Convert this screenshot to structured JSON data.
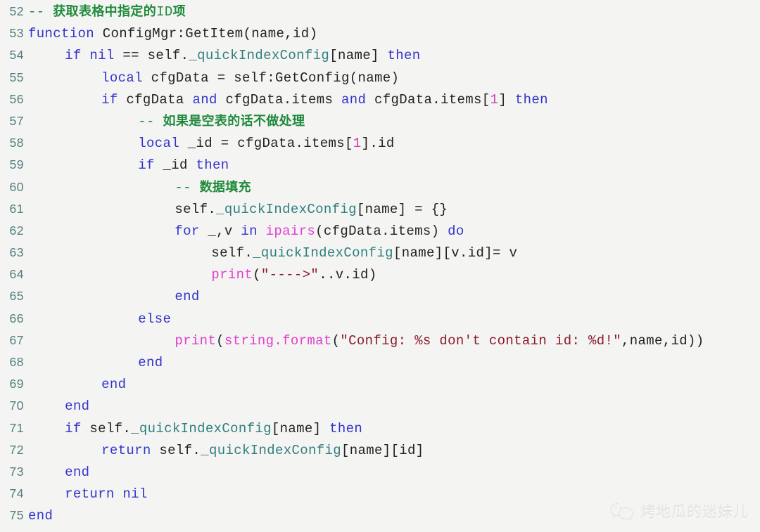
{
  "editor": {
    "language": "Lua",
    "background_color": "#f4f4f2",
    "line_number_color": "#4f7f7f",
    "first_line": 52,
    "last_line": 75
  },
  "colors": {
    "keyword": "#3333cc",
    "comment": "#1f8a3c",
    "builtin_function": "#e23fd0",
    "string": "#8b1a2b",
    "number": "#d13fb8",
    "property": "#2f7f7f",
    "plain": "#222222",
    "line_number": "#4f7f7f",
    "background": "#f4f4f2",
    "watermark": "#e6e6e4"
  },
  "lines": [
    {
      "num": "52",
      "indent": 0,
      "tokens": [
        {
          "t": "-- ",
          "c": "t-com"
        },
        {
          "t": "获取表格中指定的",
          "c": "t-com-cjk"
        },
        {
          "t": "ID",
          "c": "t-com"
        },
        {
          "t": "项",
          "c": "t-com-cjk"
        }
      ]
    },
    {
      "num": "53",
      "indent": 0,
      "tokens": [
        {
          "t": "function",
          "c": "t-kw"
        },
        {
          "t": " ConfigMgr:GetItem(name,id)",
          "c": "t-plain"
        }
      ]
    },
    {
      "num": "54",
      "indent": 4,
      "tokens": [
        {
          "t": "if",
          "c": "t-kw"
        },
        {
          "t": " ",
          "c": "t-plain"
        },
        {
          "t": "nil",
          "c": "t-kw"
        },
        {
          "t": " == self.",
          "c": "t-plain"
        },
        {
          "t": "_quickIndexConfig",
          "c": "t-prop"
        },
        {
          "t": "[name] ",
          "c": "t-plain"
        },
        {
          "t": "then",
          "c": "t-kw"
        }
      ]
    },
    {
      "num": "55",
      "indent": 8,
      "tokens": [
        {
          "t": "local",
          "c": "t-kw"
        },
        {
          "t": " cfgData = self:GetConfig(name)",
          "c": "t-plain"
        }
      ]
    },
    {
      "num": "56",
      "indent": 8,
      "tokens": [
        {
          "t": "if",
          "c": "t-kw"
        },
        {
          "t": " cfgData ",
          "c": "t-plain"
        },
        {
          "t": "and",
          "c": "t-kw"
        },
        {
          "t": " cfgData.items ",
          "c": "t-plain"
        },
        {
          "t": "and",
          "c": "t-kw"
        },
        {
          "t": " cfgData.items[",
          "c": "t-plain"
        },
        {
          "t": "1",
          "c": "t-num"
        },
        {
          "t": "] ",
          "c": "t-plain"
        },
        {
          "t": "then",
          "c": "t-kw"
        }
      ]
    },
    {
      "num": "57",
      "indent": 12,
      "tokens": [
        {
          "t": "-- ",
          "c": "t-com"
        },
        {
          "t": "如果是空表的话不做处理",
          "c": "t-com-cjk"
        }
      ]
    },
    {
      "num": "58",
      "indent": 12,
      "tokens": [
        {
          "t": "local",
          "c": "t-kw"
        },
        {
          "t": " _id = cfgData.items[",
          "c": "t-plain"
        },
        {
          "t": "1",
          "c": "t-num"
        },
        {
          "t": "].id",
          "c": "t-plain"
        }
      ]
    },
    {
      "num": "59",
      "indent": 12,
      "tokens": [
        {
          "t": "if",
          "c": "t-kw"
        },
        {
          "t": " _id ",
          "c": "t-plain"
        },
        {
          "t": "then",
          "c": "t-kw"
        }
      ]
    },
    {
      "num": "60",
      "indent": 16,
      "tokens": [
        {
          "t": "-- ",
          "c": "t-com"
        },
        {
          "t": "数据填充",
          "c": "t-com-cjk"
        }
      ]
    },
    {
      "num": "61",
      "indent": 16,
      "tokens": [
        {
          "t": "self.",
          "c": "t-plain"
        },
        {
          "t": "_quickIndexConfig",
          "c": "t-prop"
        },
        {
          "t": "[name] = {}",
          "c": "t-plain"
        }
      ]
    },
    {
      "num": "62",
      "indent": 16,
      "tokens": [
        {
          "t": "for",
          "c": "t-kw"
        },
        {
          "t": " _,v ",
          "c": "t-plain"
        },
        {
          "t": "in",
          "c": "t-kw"
        },
        {
          "t": " ",
          "c": "t-plain"
        },
        {
          "t": "ipairs",
          "c": "t-fn"
        },
        {
          "t": "(cfgData.items) ",
          "c": "t-plain"
        },
        {
          "t": "do",
          "c": "t-kw"
        }
      ]
    },
    {
      "num": "63",
      "indent": 20,
      "tokens": [
        {
          "t": "self.",
          "c": "t-plain"
        },
        {
          "t": "_quickIndexConfig",
          "c": "t-prop"
        },
        {
          "t": "[name][v.id]= v",
          "c": "t-plain"
        }
      ]
    },
    {
      "num": "64",
      "indent": 20,
      "tokens": [
        {
          "t": "print",
          "c": "t-fn"
        },
        {
          "t": "(",
          "c": "t-plain"
        },
        {
          "t": "\"---->\"",
          "c": "t-str"
        },
        {
          "t": "..v.id)",
          "c": "t-plain"
        }
      ]
    },
    {
      "num": "65",
      "indent": 16,
      "tokens": [
        {
          "t": "end",
          "c": "t-kw"
        }
      ]
    },
    {
      "num": "66",
      "indent": 12,
      "tokens": [
        {
          "t": "else",
          "c": "t-kw"
        }
      ]
    },
    {
      "num": "67",
      "indent": 16,
      "tokens": [
        {
          "t": "print",
          "c": "t-fn"
        },
        {
          "t": "(",
          "c": "t-plain"
        },
        {
          "t": "string.format",
          "c": "t-fn"
        },
        {
          "t": "(",
          "c": "t-plain"
        },
        {
          "t": "\"Config: %s don't contain id: %d!\"",
          "c": "t-str"
        },
        {
          "t": ",name,id))",
          "c": "t-plain"
        }
      ]
    },
    {
      "num": "68",
      "indent": 12,
      "tokens": [
        {
          "t": "end",
          "c": "t-kw"
        }
      ]
    },
    {
      "num": "69",
      "indent": 8,
      "tokens": [
        {
          "t": "end",
          "c": "t-kw"
        }
      ]
    },
    {
      "num": "70",
      "indent": 4,
      "tokens": [
        {
          "t": "end",
          "c": "t-kw"
        }
      ]
    },
    {
      "num": "71",
      "indent": 4,
      "tokens": [
        {
          "t": "if",
          "c": "t-kw"
        },
        {
          "t": " self.",
          "c": "t-plain"
        },
        {
          "t": "_quickIndexConfig",
          "c": "t-prop"
        },
        {
          "t": "[name] ",
          "c": "t-plain"
        },
        {
          "t": "then",
          "c": "t-kw"
        }
      ]
    },
    {
      "num": "72",
      "indent": 8,
      "tokens": [
        {
          "t": "return",
          "c": "t-kw"
        },
        {
          "t": " self.",
          "c": "t-plain"
        },
        {
          "t": "_quickIndexConfig",
          "c": "t-prop"
        },
        {
          "t": "[name][id]",
          "c": "t-plain"
        }
      ]
    },
    {
      "num": "73",
      "indent": 4,
      "tokens": [
        {
          "t": "end",
          "c": "t-kw"
        }
      ]
    },
    {
      "num": "74",
      "indent": 4,
      "tokens": [
        {
          "t": "return",
          "c": "t-kw"
        },
        {
          "t": " ",
          "c": "t-plain"
        },
        {
          "t": "nil",
          "c": "t-kw"
        }
      ]
    },
    {
      "num": "75",
      "indent": 0,
      "tokens": [
        {
          "t": "end",
          "c": "t-kw"
        }
      ]
    }
  ],
  "watermark": {
    "icon": "wechat-icon",
    "text": "烤地瓜的迷妹儿"
  }
}
